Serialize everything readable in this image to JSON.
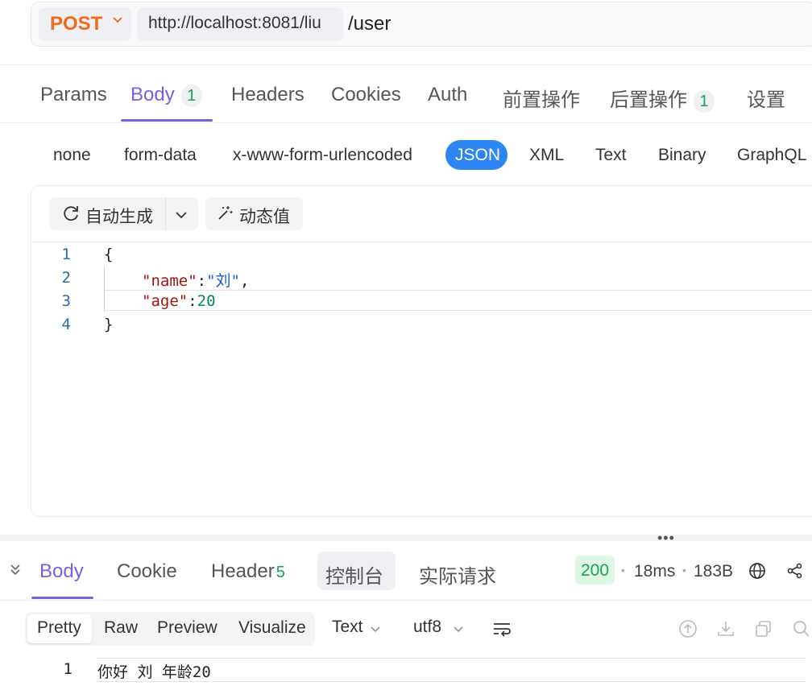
{
  "request": {
    "method": "POST",
    "base_url": "http://localhost:8081/liu",
    "path": "/user"
  },
  "request_tabs": [
    {
      "label": "Params",
      "badge": null
    },
    {
      "label": "Body",
      "badge": "1",
      "active": true
    },
    {
      "label": "Headers",
      "badge": null
    },
    {
      "label": "Cookies",
      "badge": null
    },
    {
      "label": "Auth",
      "badge": null
    },
    {
      "label": "前置操作",
      "badge": null
    },
    {
      "label": "后置操作",
      "badge": "1"
    },
    {
      "label": "设置",
      "badge": null
    }
  ],
  "body_types": [
    "none",
    "form-data",
    "x-www-form-urlencoded",
    "JSON",
    "XML",
    "Text",
    "Binary",
    "GraphQL"
  ],
  "body_type_selected": "JSON",
  "editor_toolbar": {
    "auto_generate": "自动生成",
    "dynamic_value": "动态值"
  },
  "editor": {
    "line_numbers": [
      "1",
      "2",
      "3",
      "4"
    ],
    "lines": [
      {
        "text": "{"
      },
      {
        "key": "\"name\"",
        "colon": ":",
        "value": "\"刘\"",
        "trail": ","
      },
      {
        "key": "\"age\"",
        "colon": ":",
        "value": "20",
        "trail": ""
      },
      {
        "text": "}"
      }
    ]
  },
  "response_tabs": [
    {
      "label": "Body",
      "active": true
    },
    {
      "label": "Cookie"
    },
    {
      "label": "Header",
      "badge": "5"
    },
    {
      "label": "控制台",
      "highlighted": true
    },
    {
      "label": "实际请求"
    }
  ],
  "response_meta": {
    "status": "200",
    "time": "18ms",
    "size": "183B"
  },
  "response_view": {
    "modes": [
      "Pretty",
      "Raw",
      "Preview",
      "Visualize"
    ],
    "selected": "Pretty",
    "format": "Text",
    "encoding": "utf8"
  },
  "response_body": {
    "line_number": "1",
    "text": "你好 刘 年龄20"
  },
  "colors": {
    "method": "#f06a1d",
    "accent": "#7b5fe0",
    "json_pill": "#2e86f5",
    "success": "#1aa35a"
  }
}
